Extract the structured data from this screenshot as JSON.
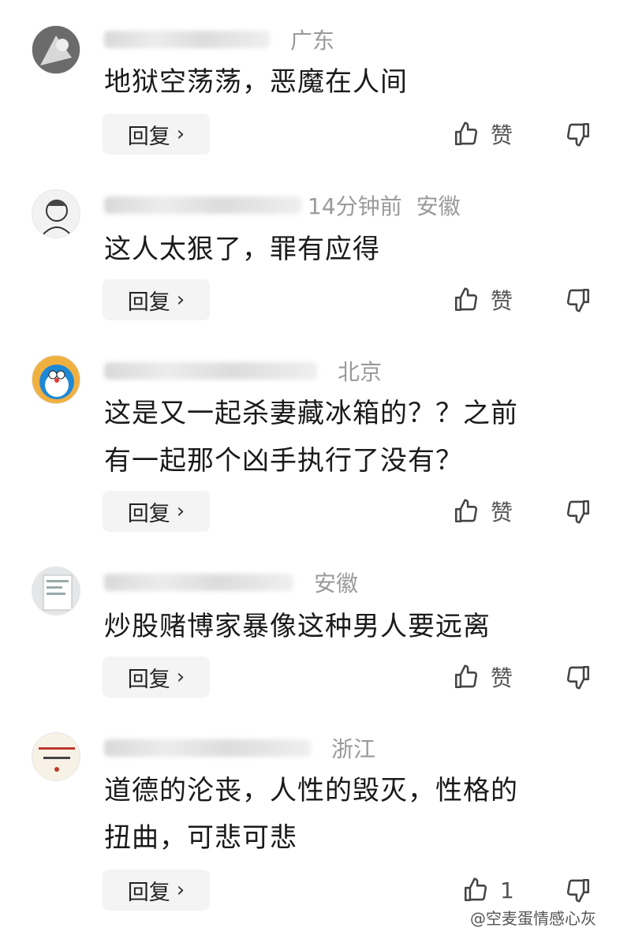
{
  "comments": [
    {
      "region": "广东",
      "time": "",
      "text_lines": [
        "地狱空荡荡，恶魔在人间"
      ],
      "reply_label": "回复",
      "like_label": "赞"
    },
    {
      "region": "安徽",
      "time": "14分钟前",
      "text_lines": [
        "这人太狠了，罪有应得"
      ],
      "reply_label": "回复",
      "like_label": "赞"
    },
    {
      "region": "北京",
      "time": "",
      "text_lines": [
        "这是又一起杀妻藏冰箱的？？之前",
        "有一起那个凶手执行了没有？"
      ],
      "reply_label": "回复",
      "like_label": "赞"
    },
    {
      "region": "安徽",
      "time": "",
      "text_lines": [
        "炒股赌博家暴像这种男人要远离"
      ],
      "reply_label": "回复",
      "like_label": "赞"
    },
    {
      "region": "浙江",
      "time": "",
      "text_lines": [
        "道德的沦丧，人性的毁灭，性格的",
        "扭曲，可悲可悲"
      ],
      "reply_label": "回复",
      "like_label": "1"
    }
  ],
  "icons": {
    "like": "thumbs-up-icon",
    "dislike": "thumbs-down-icon",
    "chevron": "chevron-right-icon"
  },
  "watermark": "@空麦蛋情感心灰",
  "colors": {
    "meta_text": "#9a9a9a",
    "reply_bg": "#f4f4f4"
  }
}
